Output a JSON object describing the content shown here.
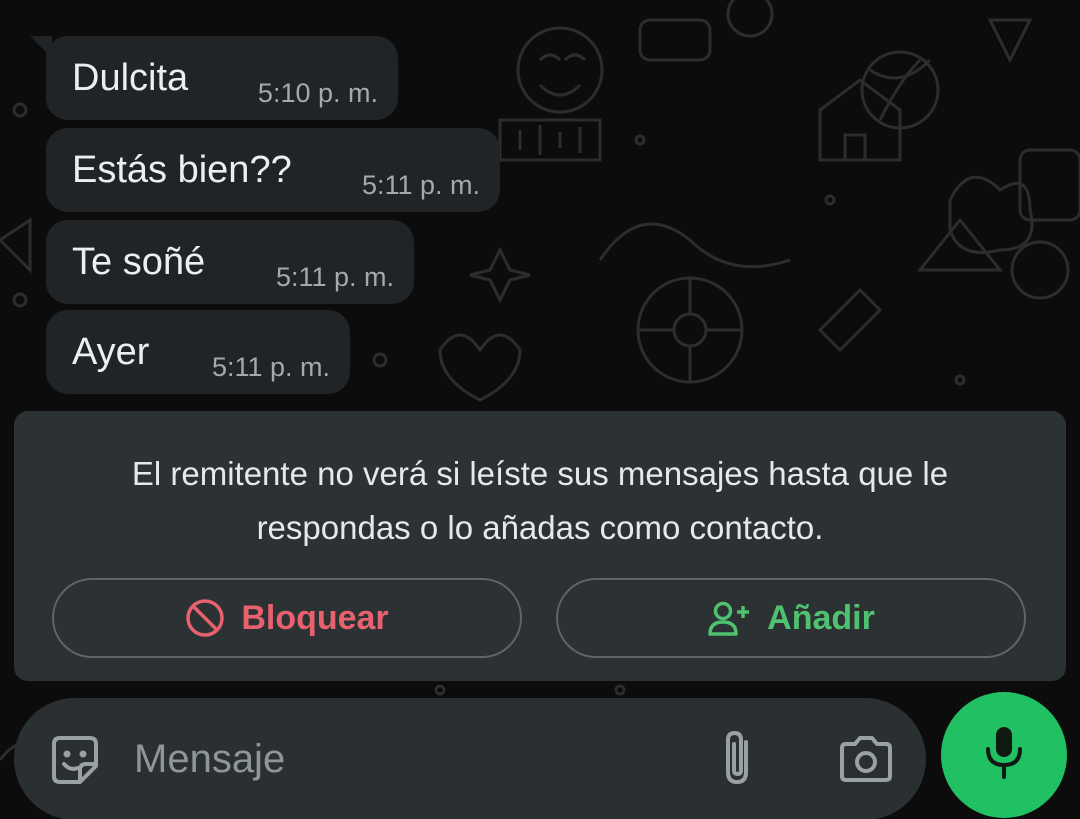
{
  "messages": [
    {
      "text": "Dulcita",
      "time": "5:10 p. m."
    },
    {
      "text": "Estás bien??",
      "time": "5:11 p. m."
    },
    {
      "text": "Te soñé",
      "time": "5:11 p. m."
    },
    {
      "text": "Ayer",
      "time": "5:11 p. m."
    }
  ],
  "notice": {
    "text": "El remitente no verá si leíste sus mensajes hasta que le respondas o lo añadas como contacto.",
    "block_label": "Bloquear",
    "add_label": "Añadir"
  },
  "composer": {
    "placeholder": "Mensaje"
  },
  "icons": {
    "block": "block-icon",
    "add_contact": "add-contact-icon",
    "emoji": "sticker-emoji-icon",
    "attach": "paperclip-icon",
    "camera": "camera-icon",
    "mic": "microphone-icon"
  },
  "colors": {
    "bubble": "#202427",
    "panel": "#2c3134",
    "block": "#e7616e",
    "add": "#4fc16f",
    "mic_button": "#21c063"
  }
}
